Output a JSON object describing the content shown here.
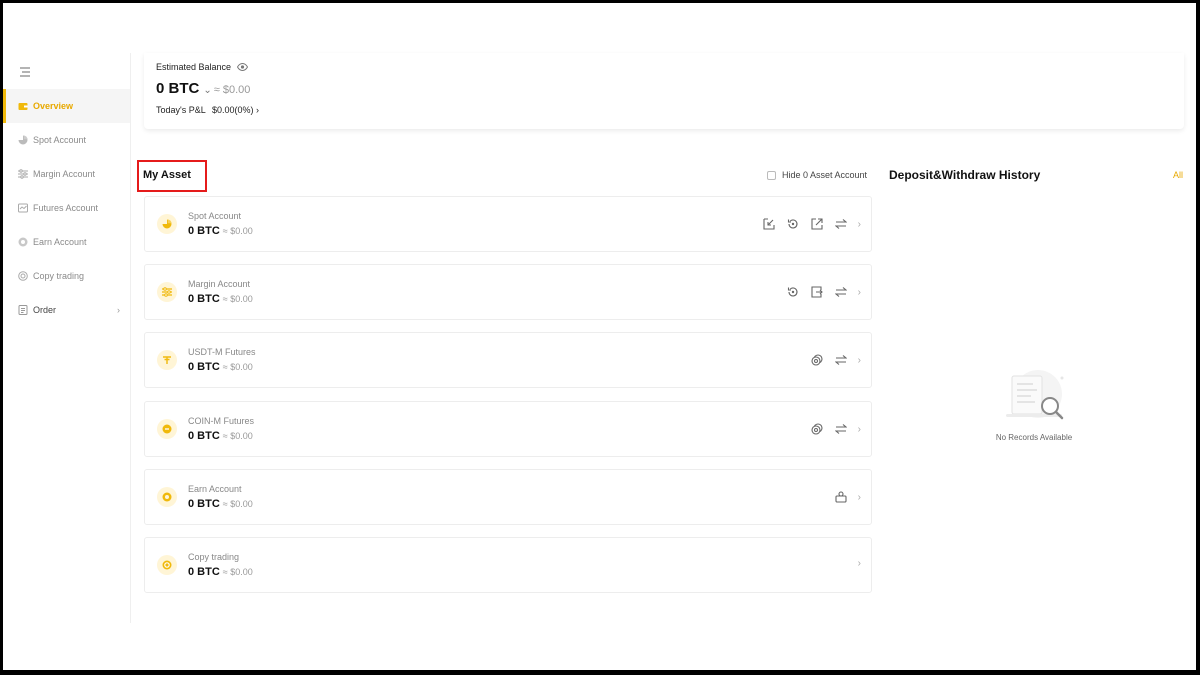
{
  "sidebar": {
    "items": [
      {
        "label": "Overview",
        "icon": "wallet-icon",
        "active": true
      },
      {
        "label": "Spot Account",
        "icon": "pie-chart-icon"
      },
      {
        "label": "Margin Account",
        "icon": "sliders-icon"
      },
      {
        "label": "Futures Account",
        "icon": "futures-icon"
      },
      {
        "label": "Earn Account",
        "icon": "earn-icon"
      },
      {
        "label": "Copy trading",
        "icon": "copy-trading-icon"
      },
      {
        "label": "Order",
        "icon": "order-icon"
      }
    ]
  },
  "balance": {
    "label": "Estimated Balance",
    "btc": "0 BTC",
    "usd": "≈ $0.00",
    "pnl_label": "Today's P&L",
    "pnl_value": "$0.00(0%)"
  },
  "assets": {
    "title": "My Asset",
    "hide_zero_label": "Hide 0 Asset Account",
    "rows": [
      {
        "name": "Spot Account",
        "btc": "0 BTC",
        "usd": "≈ $0.00",
        "actions": [
          "deposit-icon",
          "history-icon",
          "withdraw-icon",
          "transfer-icon"
        ]
      },
      {
        "name": "Margin Account",
        "btc": "0 BTC",
        "usd": "≈ $0.00",
        "actions": [
          "history-icon",
          "exit-icon",
          "transfer-icon"
        ]
      },
      {
        "name": "USDT-M Futures",
        "btc": "0 BTC",
        "usd": "≈ $0.00",
        "actions": [
          "coins-icon",
          "transfer-icon"
        ]
      },
      {
        "name": "COIN-M Futures",
        "btc": "0 BTC",
        "usd": "≈ $0.00",
        "actions": [
          "coins-icon",
          "transfer-icon"
        ]
      },
      {
        "name": "Earn Account",
        "btc": "0 BTC",
        "usd": "≈ $0.00",
        "actions": [
          "bag-icon"
        ]
      },
      {
        "name": "Copy trading",
        "btc": "0 BTC",
        "usd": "≈ $0.00",
        "actions": []
      }
    ]
  },
  "history": {
    "title": "Deposit&Withdraw History",
    "all_label": "All",
    "empty_text": "No Records Available"
  },
  "colors": {
    "accent": "#f0b90b",
    "highlight_box": "#e51b1b"
  }
}
